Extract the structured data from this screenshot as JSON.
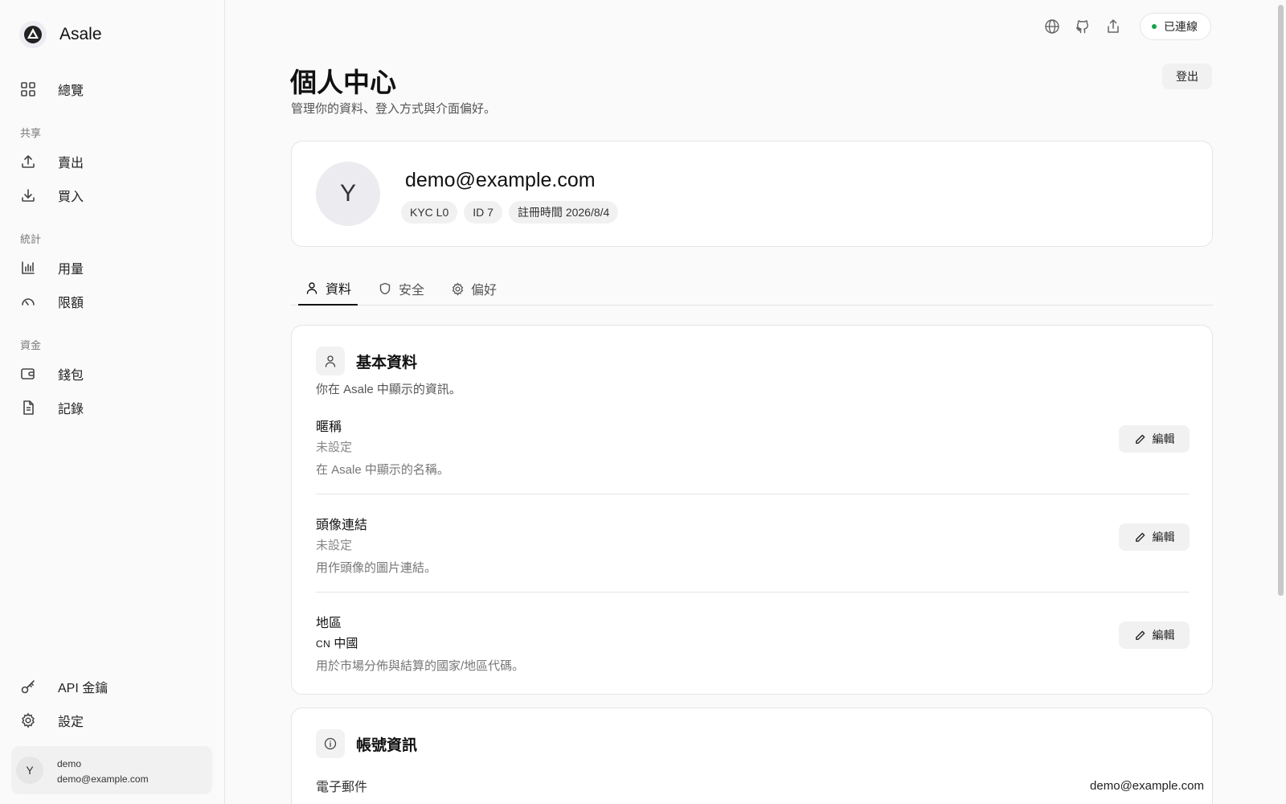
{
  "app": {
    "name": "Asale"
  },
  "sidebar": {
    "overview": "總覽",
    "sections": [
      {
        "title": "共享",
        "items": [
          {
            "label": "賣出",
            "icon": "upload-icon"
          },
          {
            "label": "買入",
            "icon": "download-icon"
          }
        ]
      },
      {
        "title": "統計",
        "items": [
          {
            "label": "用量",
            "icon": "bar-chart-icon"
          },
          {
            "label": "限額",
            "icon": "gauge-icon"
          }
        ]
      },
      {
        "title": "資金",
        "items": [
          {
            "label": "錢包",
            "icon": "wallet-icon"
          },
          {
            "label": "記錄",
            "icon": "document-icon"
          }
        ]
      }
    ],
    "bottom": [
      {
        "label": "API 金鑰",
        "icon": "key-icon"
      },
      {
        "label": "設定",
        "icon": "gear-icon"
      }
    ],
    "user": {
      "avatar": "Y",
      "name": "demo",
      "email": "demo@example.com"
    }
  },
  "topbar": {
    "icons": [
      "globe-icon",
      "github-icon",
      "share-icon"
    ],
    "status": {
      "label": "已連線",
      "color": "#16a34a"
    }
  },
  "header": {
    "title": "個人中心",
    "subtitle": "管理你的資料、登入方式與介面偏好。",
    "logout": "登出"
  },
  "profile": {
    "avatar": "Y",
    "email": "demo@example.com",
    "badges": [
      "KYC L0",
      "ID 7",
      "註冊時間 2026/8/4"
    ]
  },
  "tabs": [
    {
      "label": "資料",
      "icon": "user-icon",
      "active": true
    },
    {
      "label": "安全",
      "icon": "shield-icon",
      "active": false
    },
    {
      "label": "偏好",
      "icon": "gear-icon",
      "active": false
    }
  ],
  "basic": {
    "title": "基本資料",
    "description": "你在 Asale 中顯示的資訊。",
    "edit_label": "編輯",
    "fields": [
      {
        "label": "暱稱",
        "value": "未設定",
        "help": "在 Asale 中顯示的名稱。"
      },
      {
        "label": "頭像連結",
        "value": "未設定",
        "help": "用作頭像的圖片連結。"
      },
      {
        "label": "地區",
        "country_code": "CN",
        "value": "中國",
        "help": "用於市場分佈與結算的國家/地區代碼。"
      }
    ]
  },
  "account": {
    "title": "帳號資訊",
    "email_label": "電子郵件",
    "email_value": "demo@example.com"
  }
}
